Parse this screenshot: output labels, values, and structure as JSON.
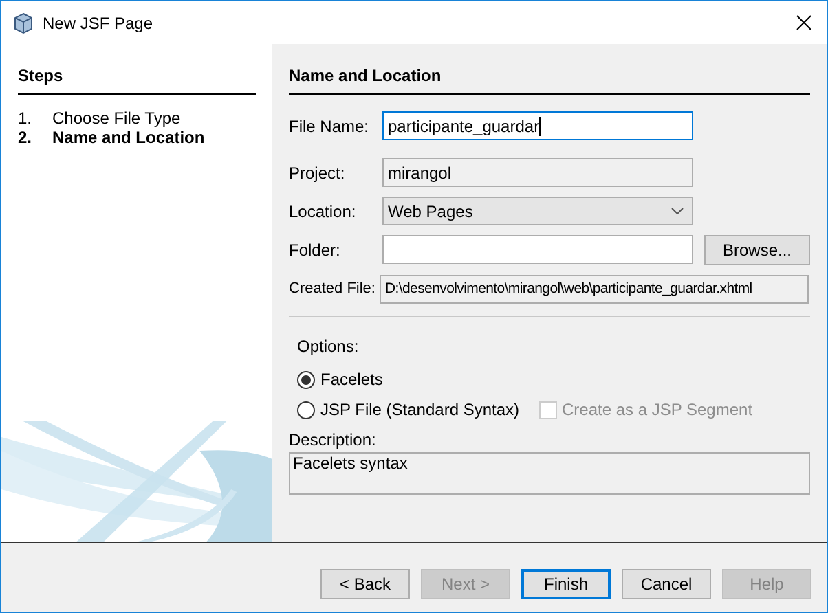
{
  "window": {
    "title": "New JSF Page"
  },
  "steps": {
    "title": "Steps",
    "items": [
      {
        "number": "1.",
        "label": "Choose File Type",
        "selected": false
      },
      {
        "number": "2.",
        "label": "Name and Location",
        "selected": true
      }
    ]
  },
  "panel": {
    "title": "Name and Location",
    "fields": [
      {
        "kind": "text",
        "label": "File Name:",
        "value": "participante_guardar",
        "focused": true
      },
      {
        "kind": "readonly",
        "label": "Project:",
        "value": "mirangol"
      },
      {
        "kind": "dropdown",
        "label": "Location:",
        "value": "Web Pages"
      },
      {
        "kind": "browse",
        "label": "Folder:",
        "button": "Browse..."
      },
      {
        "kind": "readonly-wide",
        "label": "Created File:",
        "value": "D:\\desenvolvimento\\mirangol\\web\\participante_guardar.xhtml"
      }
    ],
    "options": {
      "label": "Options:",
      "radios": [
        {
          "label": "Facelets",
          "selected": true
        },
        {
          "label": "JSP File (Standard Syntax)",
          "selected": false
        }
      ],
      "checkbox": {
        "label": "Create as a JSP Segment",
        "checked": false,
        "disabled": true
      }
    },
    "description": {
      "label": "Description:",
      "value": "Facelets syntax"
    }
  },
  "buttons": [
    {
      "label": "< Back",
      "disabled": false,
      "default": false
    },
    {
      "label": "Next >",
      "disabled": true,
      "default": false
    },
    {
      "label": "Finish",
      "disabled": false,
      "default": true
    },
    {
      "label": "Cancel",
      "disabled": false,
      "default": false
    },
    {
      "label": "Help",
      "disabled": true,
      "default": false
    }
  ]
}
